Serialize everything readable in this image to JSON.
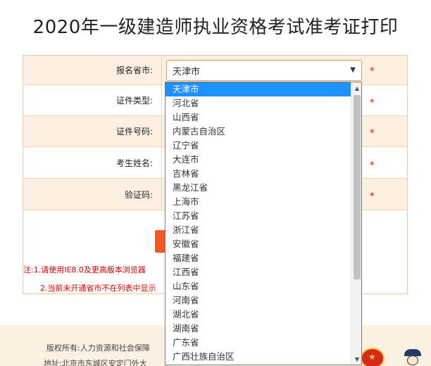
{
  "page": {
    "title": "2020年一级建造师执业资格考试准考证打印"
  },
  "form": {
    "rows": [
      {
        "label": "报名省市:",
        "required": "*"
      },
      {
        "label": "证件类型:",
        "required": "*"
      },
      {
        "label": "证件号码:",
        "required": "*"
      },
      {
        "label": "考生姓名:",
        "required": "*"
      },
      {
        "label": "验证码:",
        "required": "*"
      }
    ],
    "province_select": {
      "value": "天津市",
      "caret": "▼"
    }
  },
  "notes": {
    "line1": "注:1.请使用IE8.0及更高版本浏览器",
    "line2": "2.当前未开通省市不在列表中显示"
  },
  "dropdown": {
    "options": [
      "天津市",
      "河北省",
      "山西省",
      "内蒙古自治区",
      "辽宁省",
      "大连市",
      "吉林省",
      "黑龙江省",
      "上海市",
      "江苏省",
      "浙江省",
      "安徽省",
      "福建省",
      "江西省",
      "山东省",
      "河南省",
      "湖北省",
      "湖南省",
      "广东省",
      "广西壮族自治区"
    ],
    "selected_index": 0,
    "scroll_up": "▲",
    "scroll_down": "▼"
  },
  "footer": {
    "copyright": "版权所有:人力资源和社会保障",
    "address": "地址:北京市东城区安定门外大"
  },
  "colors": {
    "accent": "#f05a22",
    "row_shade": "#fdf0e3",
    "selection": "#1e90ff",
    "required": "#ee0000"
  }
}
